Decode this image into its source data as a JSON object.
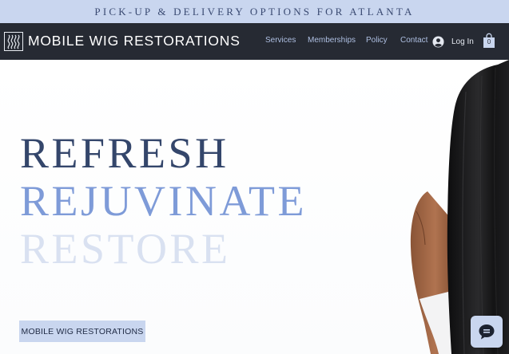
{
  "announcement": {
    "text": "PICK-UP & DELIVERY OPTIONS FOR ATLANTA"
  },
  "header": {
    "brand": "MOBILE WIG RESTORATIONS",
    "nav": [
      {
        "label": "Services"
      },
      {
        "label": "Memberships"
      },
      {
        "label": "Policy"
      },
      {
        "label": "Contact"
      }
    ],
    "login_label": "Log In",
    "cart_count": "0",
    "icons": {
      "logo": "wave-logo-icon",
      "account": "account-icon",
      "cart": "shopping-bag-icon"
    }
  },
  "hero": {
    "line1": "REFRESH",
    "line2": "REJUVINATE",
    "line3": "RESTORE",
    "cta_label": "MOBILE WIG RESTORATIONS",
    "colors": {
      "line1": "#34466b",
      "line2": "#7e9bd8",
      "line3": "#d9e1f1",
      "accent": "#c9d6ef",
      "nav_bg": "#262a33"
    }
  },
  "chat": {
    "icon": "chat-icon"
  }
}
